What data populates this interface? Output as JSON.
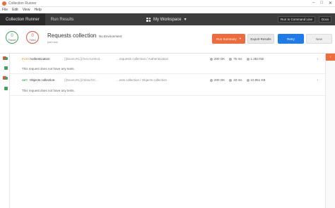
{
  "window": {
    "title": "Collection Runner",
    "controls": [
      "–",
      "□",
      "✕"
    ]
  },
  "menu": [
    "File",
    "Edit",
    "View",
    "Help"
  ],
  "nav": {
    "tab_runner": "Collection Runner",
    "tab_results": "Run Results",
    "workspace": "My Workspace",
    "workspace_caret": "▾",
    "run_in_command_line": "Run In Command Line",
    "docs": "Docs"
  },
  "summary": {
    "passed_count": "0",
    "passed_label": "Passed",
    "failed_count": "0",
    "failed_label": "Failed",
    "collection_name": "Requests collection",
    "environment": "No Environment",
    "time": "just now",
    "run_summary": "Run Summary",
    "run_summary_caret": "▾",
    "export_results": "Export Results",
    "retry": "Retry",
    "new": "New"
  },
  "results": [
    {
      "method": "POST",
      "method_color": "#e8a23a",
      "name": "Authentication",
      "url": "{{BaseURL}}/ServiceMod...",
      "path": "...requests collection / Authentication",
      "status": "200 OK",
      "time": "76 ms",
      "size": "1.383 KB",
      "note": "This request does not have any tests."
    },
    {
      "method": "GET",
      "method_color": "#3fa35f",
      "name": "Objects collection",
      "url": "{{BaseURL}}/Idata/SC...",
      "path": "...ests collection / Objects collection",
      "status": "200 OK",
      "time": "33 ms",
      "size": "10.951 KB",
      "note": "This request does not have any tests."
    }
  ],
  "colors": {
    "passed": "#3fa35f",
    "failed": "#e0543b",
    "accent": "#ef6b3c",
    "retry": "#1e7be8",
    "navbar": "#3d3d3d"
  },
  "icons": {
    "expand": "›",
    "scroll_tab": "‹"
  }
}
